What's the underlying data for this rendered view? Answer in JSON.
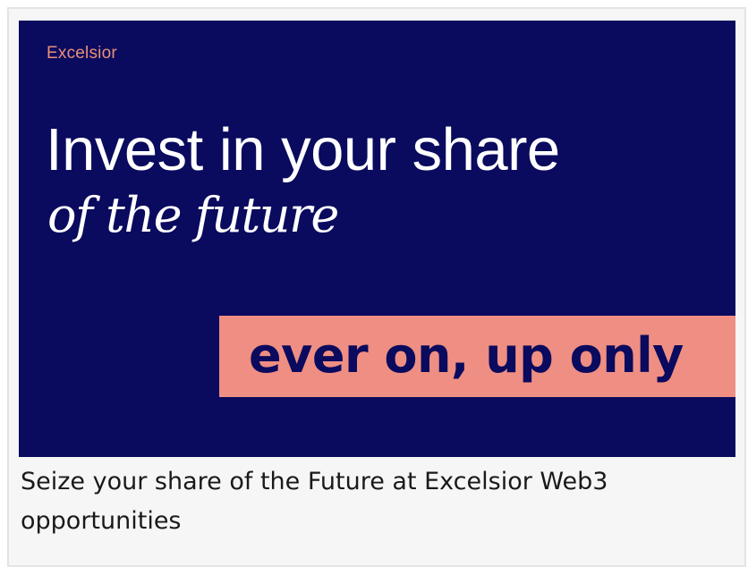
{
  "banner": {
    "brand": "Excelsior",
    "headline_line1": "Invest in your share",
    "headline_line2": "of the future",
    "tagline": "ever on, up only",
    "colors": {
      "background": "#0a0a5e",
      "accent": "#ef8e82",
      "brand_text": "#e8907a",
      "headline_text": "#ffffff"
    }
  },
  "caption": "Seize your share of the Future at Excelsior Web3 opportunities"
}
